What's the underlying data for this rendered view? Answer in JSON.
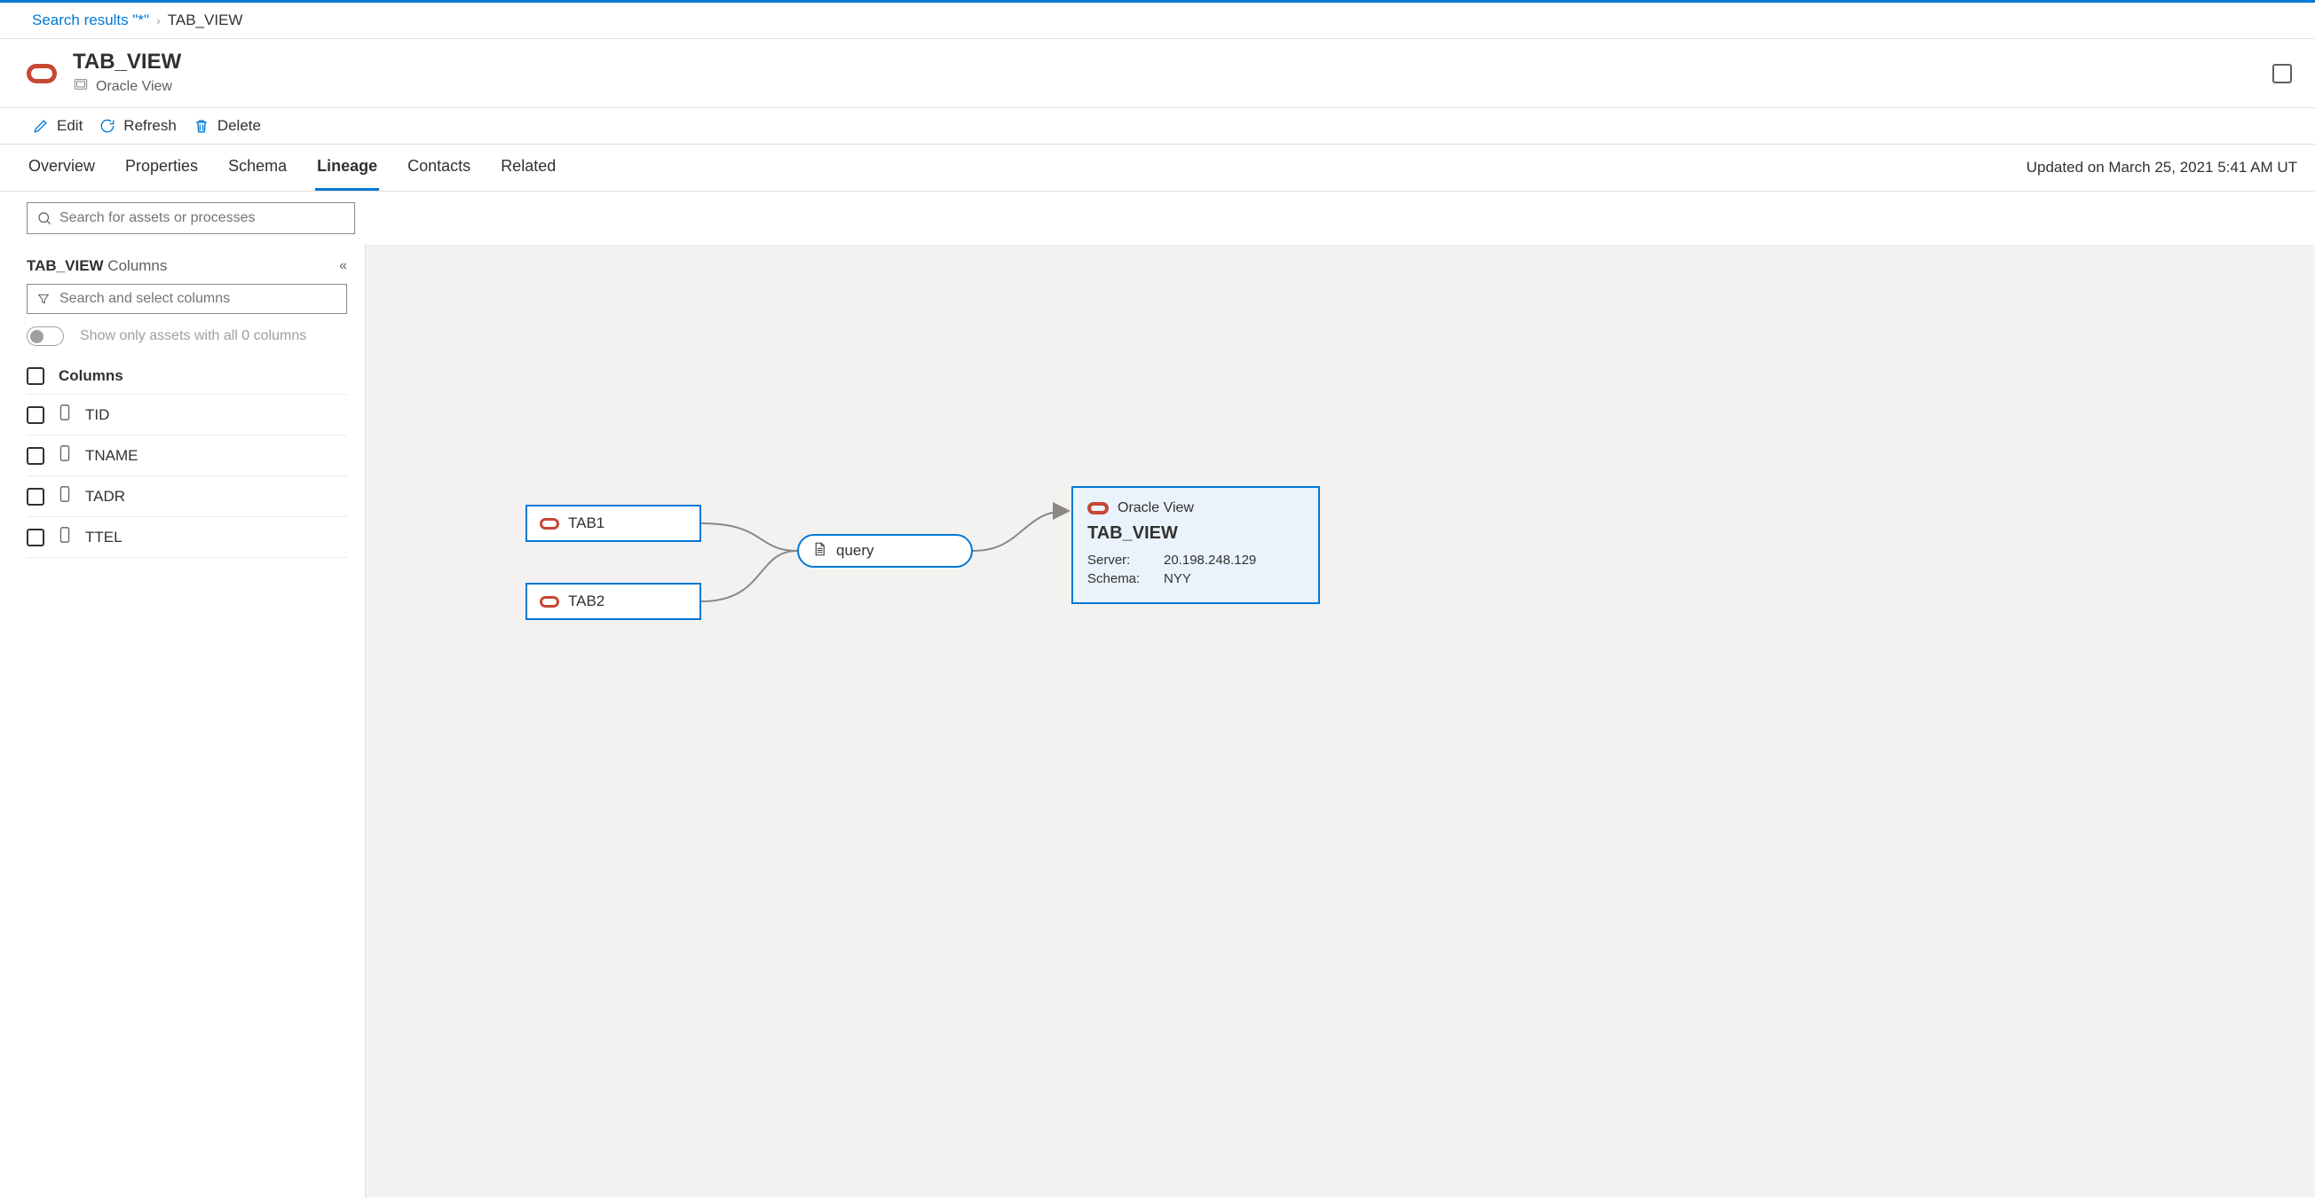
{
  "breadcrumb": {
    "root": "Search results \"*\"",
    "current": "TAB_VIEW"
  },
  "header": {
    "title": "TAB_VIEW",
    "subtitle": "Oracle View"
  },
  "toolbar": {
    "edit": "Edit",
    "refresh": "Refresh",
    "delete": "Delete"
  },
  "tabs": {
    "items": [
      "Overview",
      "Properties",
      "Schema",
      "Lineage",
      "Contacts",
      "Related"
    ],
    "active_index": 3,
    "updated_text": "Updated on March 25, 2021 5:41 AM UT"
  },
  "search": {
    "placeholder": "Search for assets or processes"
  },
  "sidebar": {
    "title_entity": "TAB_VIEW",
    "title_suffix": "Columns",
    "filter_placeholder": "Search and select columns",
    "toggle_label": "Show only assets with all 0 columns",
    "columns_header": "Columns",
    "columns": [
      {
        "name": "TID"
      },
      {
        "name": "TNAME"
      },
      {
        "name": "TADR"
      },
      {
        "name": "TTEL"
      }
    ]
  },
  "lineage": {
    "nodes": {
      "tab1": {
        "label": "TAB1"
      },
      "tab2": {
        "label": "TAB2"
      },
      "query": {
        "label": "query"
      },
      "detail": {
        "type_label": "Oracle View",
        "title": "TAB_VIEW",
        "server_label": "Server:",
        "server_value": "20.198.248.129",
        "schema_label": "Schema:",
        "schema_value": "NYY"
      }
    }
  }
}
